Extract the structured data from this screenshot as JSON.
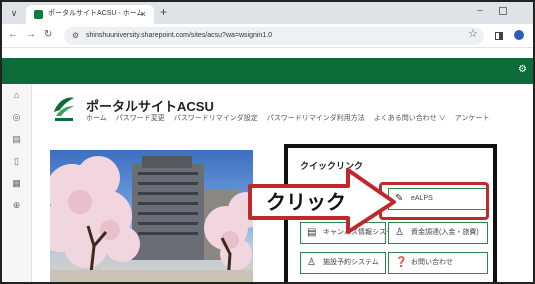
{
  "browser": {
    "tab_title": "ポータルサイトACSU - ホーム",
    "tab_close": "×",
    "new_tab": "+",
    "url": "shinshuuniversity.sharepoint.com/sites/acsu?wa=wsignin1.0",
    "minimize": "−"
  },
  "site": {
    "title": "ポータルサイトACSU",
    "nav": [
      "ホーム",
      "パスワード変更",
      "パスワードリマインダ設定",
      "パスワードリマインダ利用方法",
      "よくある問い合わせ ∨",
      "アンケート"
    ]
  },
  "quick_links": {
    "title": "クイックリンク",
    "items": [
      {
        "icon": "pencil-icon",
        "label": "eALPS"
      },
      {
        "icon": "document-icon",
        "label": "キャンパス情報システム"
      },
      {
        "icon": "person-icon",
        "label": "資金調達(入金・旅費)"
      },
      {
        "icon": "person-icon",
        "label": "施設予約システム"
      },
      {
        "icon": "question-icon",
        "label": "お問い合わせ"
      }
    ]
  },
  "annotation": {
    "callout_text": "クリック",
    "color": "#c0282d"
  },
  "colors": {
    "brand_green": "#0d6b3a",
    "link_border": "#2d8a4e"
  }
}
